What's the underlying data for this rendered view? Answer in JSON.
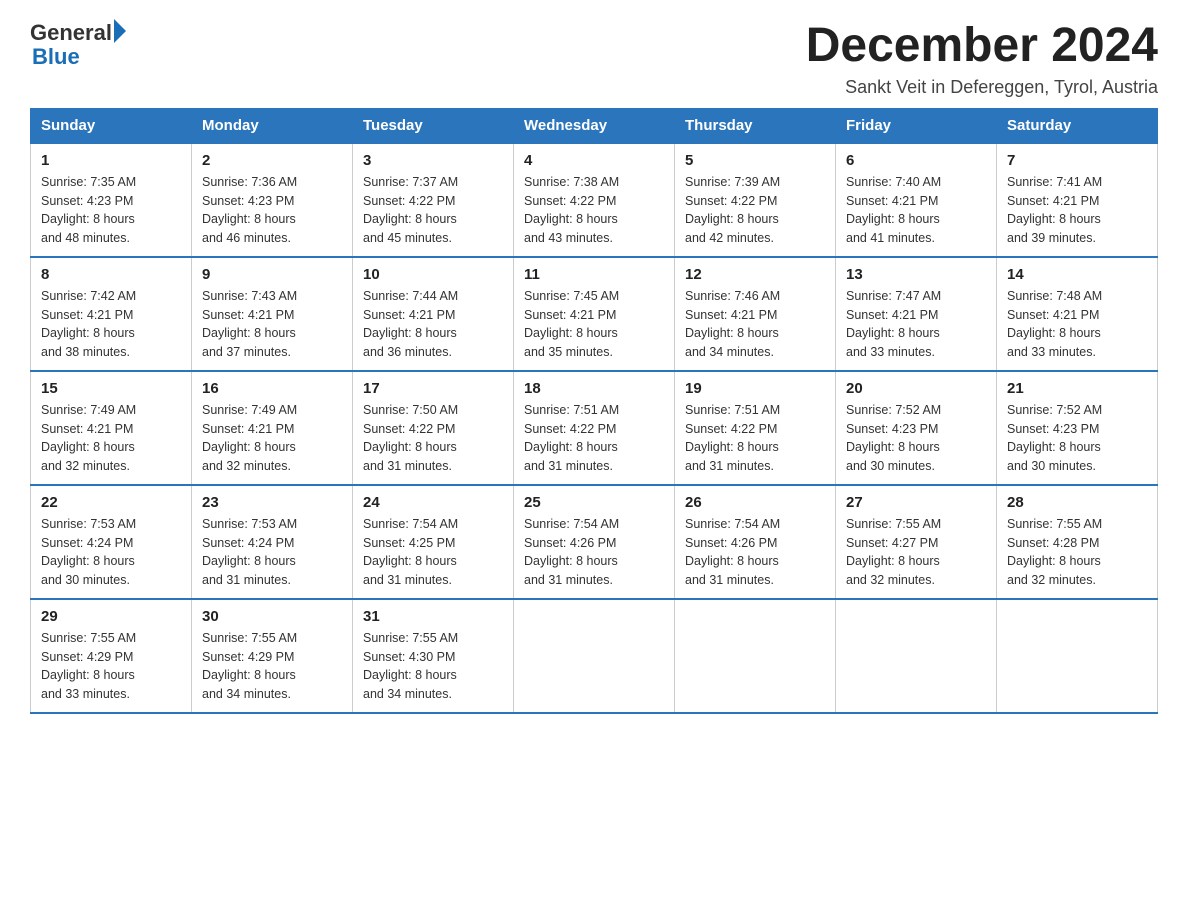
{
  "header": {
    "logo_general": "General",
    "logo_blue": "Blue",
    "month_title": "December 2024",
    "location": "Sankt Veit in Defereggen, Tyrol, Austria"
  },
  "days_of_week": [
    "Sunday",
    "Monday",
    "Tuesday",
    "Wednesday",
    "Thursday",
    "Friday",
    "Saturday"
  ],
  "weeks": [
    [
      {
        "day": "1",
        "sunrise": "7:35 AM",
        "sunset": "4:23 PM",
        "daylight_hours": "8 hours",
        "daylight_mins": "and 48 minutes."
      },
      {
        "day": "2",
        "sunrise": "7:36 AM",
        "sunset": "4:23 PM",
        "daylight_hours": "8 hours",
        "daylight_mins": "and 46 minutes."
      },
      {
        "day": "3",
        "sunrise": "7:37 AM",
        "sunset": "4:22 PM",
        "daylight_hours": "8 hours",
        "daylight_mins": "and 45 minutes."
      },
      {
        "day": "4",
        "sunrise": "7:38 AM",
        "sunset": "4:22 PM",
        "daylight_hours": "8 hours",
        "daylight_mins": "and 43 minutes."
      },
      {
        "day": "5",
        "sunrise": "7:39 AM",
        "sunset": "4:22 PM",
        "daylight_hours": "8 hours",
        "daylight_mins": "and 42 minutes."
      },
      {
        "day": "6",
        "sunrise": "7:40 AM",
        "sunset": "4:21 PM",
        "daylight_hours": "8 hours",
        "daylight_mins": "and 41 minutes."
      },
      {
        "day": "7",
        "sunrise": "7:41 AM",
        "sunset": "4:21 PM",
        "daylight_hours": "8 hours",
        "daylight_mins": "and 39 minutes."
      }
    ],
    [
      {
        "day": "8",
        "sunrise": "7:42 AM",
        "sunset": "4:21 PM",
        "daylight_hours": "8 hours",
        "daylight_mins": "and 38 minutes."
      },
      {
        "day": "9",
        "sunrise": "7:43 AM",
        "sunset": "4:21 PM",
        "daylight_hours": "8 hours",
        "daylight_mins": "and 37 minutes."
      },
      {
        "day": "10",
        "sunrise": "7:44 AM",
        "sunset": "4:21 PM",
        "daylight_hours": "8 hours",
        "daylight_mins": "and 36 minutes."
      },
      {
        "day": "11",
        "sunrise": "7:45 AM",
        "sunset": "4:21 PM",
        "daylight_hours": "8 hours",
        "daylight_mins": "and 35 minutes."
      },
      {
        "day": "12",
        "sunrise": "7:46 AM",
        "sunset": "4:21 PM",
        "daylight_hours": "8 hours",
        "daylight_mins": "and 34 minutes."
      },
      {
        "day": "13",
        "sunrise": "7:47 AM",
        "sunset": "4:21 PM",
        "daylight_hours": "8 hours",
        "daylight_mins": "and 33 minutes."
      },
      {
        "day": "14",
        "sunrise": "7:48 AM",
        "sunset": "4:21 PM",
        "daylight_hours": "8 hours",
        "daylight_mins": "and 33 minutes."
      }
    ],
    [
      {
        "day": "15",
        "sunrise": "7:49 AM",
        "sunset": "4:21 PM",
        "daylight_hours": "8 hours",
        "daylight_mins": "and 32 minutes."
      },
      {
        "day": "16",
        "sunrise": "7:49 AM",
        "sunset": "4:21 PM",
        "daylight_hours": "8 hours",
        "daylight_mins": "and 32 minutes."
      },
      {
        "day": "17",
        "sunrise": "7:50 AM",
        "sunset": "4:22 PM",
        "daylight_hours": "8 hours",
        "daylight_mins": "and 31 minutes."
      },
      {
        "day": "18",
        "sunrise": "7:51 AM",
        "sunset": "4:22 PM",
        "daylight_hours": "8 hours",
        "daylight_mins": "and 31 minutes."
      },
      {
        "day": "19",
        "sunrise": "7:51 AM",
        "sunset": "4:22 PM",
        "daylight_hours": "8 hours",
        "daylight_mins": "and 31 minutes."
      },
      {
        "day": "20",
        "sunrise": "7:52 AM",
        "sunset": "4:23 PM",
        "daylight_hours": "8 hours",
        "daylight_mins": "and 30 minutes."
      },
      {
        "day": "21",
        "sunrise": "7:52 AM",
        "sunset": "4:23 PM",
        "daylight_hours": "8 hours",
        "daylight_mins": "and 30 minutes."
      }
    ],
    [
      {
        "day": "22",
        "sunrise": "7:53 AM",
        "sunset": "4:24 PM",
        "daylight_hours": "8 hours",
        "daylight_mins": "and 30 minutes."
      },
      {
        "day": "23",
        "sunrise": "7:53 AM",
        "sunset": "4:24 PM",
        "daylight_hours": "8 hours",
        "daylight_mins": "and 31 minutes."
      },
      {
        "day": "24",
        "sunrise": "7:54 AM",
        "sunset": "4:25 PM",
        "daylight_hours": "8 hours",
        "daylight_mins": "and 31 minutes."
      },
      {
        "day": "25",
        "sunrise": "7:54 AM",
        "sunset": "4:26 PM",
        "daylight_hours": "8 hours",
        "daylight_mins": "and 31 minutes."
      },
      {
        "day": "26",
        "sunrise": "7:54 AM",
        "sunset": "4:26 PM",
        "daylight_hours": "8 hours",
        "daylight_mins": "and 31 minutes."
      },
      {
        "day": "27",
        "sunrise": "7:55 AM",
        "sunset": "4:27 PM",
        "daylight_hours": "8 hours",
        "daylight_mins": "and 32 minutes."
      },
      {
        "day": "28",
        "sunrise": "7:55 AM",
        "sunset": "4:28 PM",
        "daylight_hours": "8 hours",
        "daylight_mins": "and 32 minutes."
      }
    ],
    [
      {
        "day": "29",
        "sunrise": "7:55 AM",
        "sunset": "4:29 PM",
        "daylight_hours": "8 hours",
        "daylight_mins": "and 33 minutes."
      },
      {
        "day": "30",
        "sunrise": "7:55 AM",
        "sunset": "4:29 PM",
        "daylight_hours": "8 hours",
        "daylight_mins": "and 34 minutes."
      },
      {
        "day": "31",
        "sunrise": "7:55 AM",
        "sunset": "4:30 PM",
        "daylight_hours": "8 hours",
        "daylight_mins": "and 34 minutes."
      },
      null,
      null,
      null,
      null
    ]
  ]
}
